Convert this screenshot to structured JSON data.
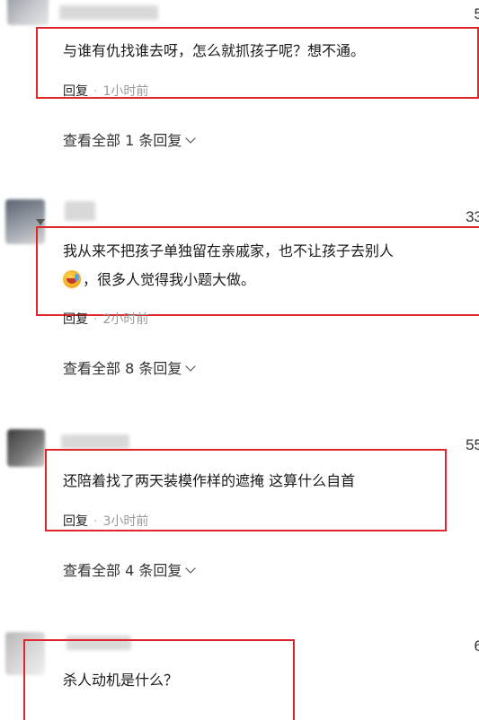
{
  "comments": [
    {
      "likes": "5",
      "content_lines": [
        "与谁有仇找谁去呀，怎么就抓孩子呢？想不通。"
      ],
      "reply_label": "回复",
      "separator": "·",
      "time": "1小时前",
      "view_all": "查看全部 1 条回复"
    },
    {
      "likes": "33",
      "content_lines": [
        "我从来不把孩子单独留在亲戚家，也不让孩子去别人",
        "，很多人觉得我小题大做。"
      ],
      "emoji": "crying-laughing-emoji",
      "reply_label": "回复",
      "separator": "·",
      "time": "2小时前",
      "view_all": "查看全部 8 条回复"
    },
    {
      "likes": "55",
      "content_lines": [
        "还陪着找了两天装模作样的遮掩 这算什么自首"
      ],
      "reply_label": "回复",
      "separator": "·",
      "time": "3小时前",
      "view_all": "查看全部 4 条回复"
    },
    {
      "likes": "6",
      "content_lines": [
        "杀人动机是什么？"
      ]
    }
  ],
  "colors": {
    "highlight_border": "#e0252b",
    "time_text": "#999999"
  }
}
